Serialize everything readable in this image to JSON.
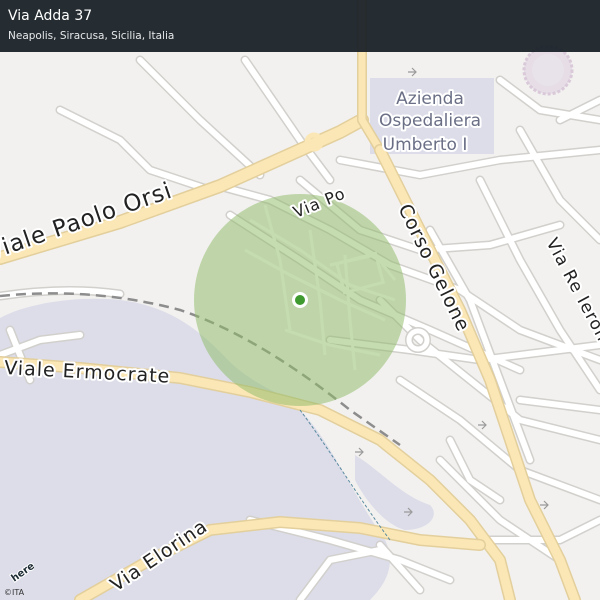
{
  "header": {
    "title": "Via Adda 37",
    "subtitle": "Neapolis, Siracusa, Sicilia, Italia"
  },
  "map": {
    "street_labels": [
      "Viale Paolo Orsi",
      "Via Po",
      "Viale Ermocrate",
      "Corso Gelone",
      "Via Re Ierone",
      "Via Elorina"
    ],
    "poi_label_lines": [
      "Azienda",
      "Ospedaliera",
      "Umberto I"
    ],
    "colors": {
      "background": "#f2f1ef",
      "water": "#dcdde9",
      "hospital_area": "#dcdde9",
      "major_road": "#fbe7b5",
      "minor_road": "#ffffff",
      "road_outline": "#d2d0cc",
      "accuracy_circle": "#8fbb6a",
      "location_dot": "#3f9a2f",
      "railway": "#8d8d8d"
    },
    "icons": [
      "location-dot-icon",
      "accuracy-circle-icon",
      "stadium-icon",
      "here-logo-icon"
    ]
  },
  "footer": {
    "logo_text": "here",
    "copyright": "©ITA"
  }
}
